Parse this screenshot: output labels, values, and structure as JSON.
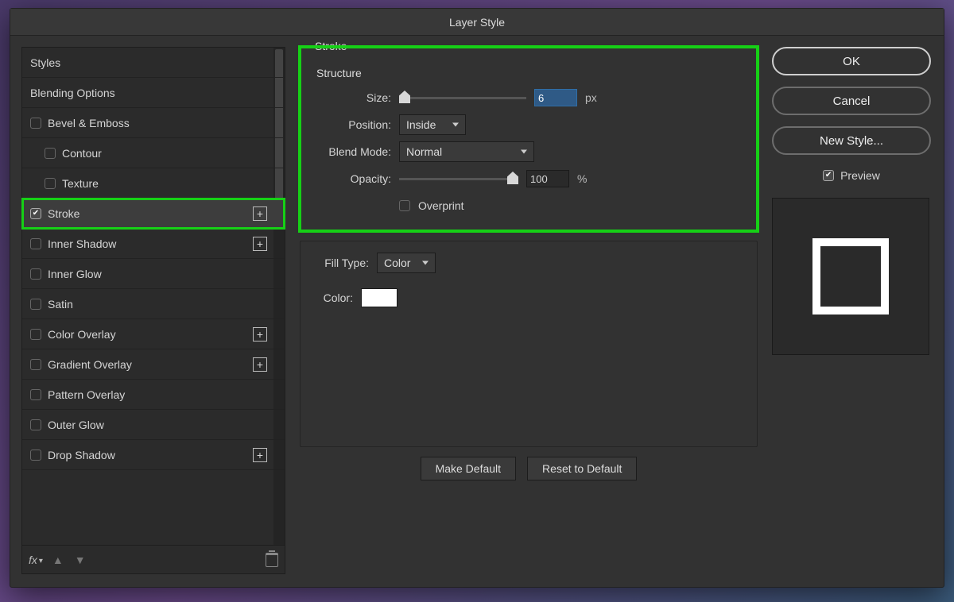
{
  "dialog": {
    "title": "Layer Style"
  },
  "sidebar": {
    "header_styles": "Styles",
    "header_blending": "Blending Options",
    "items": [
      {
        "label": "Bevel & Emboss",
        "checked": false,
        "plus": false,
        "indent": 0
      },
      {
        "label": "Contour",
        "checked": false,
        "plus": false,
        "indent": 1
      },
      {
        "label": "Texture",
        "checked": false,
        "plus": false,
        "indent": 1
      },
      {
        "label": "Stroke",
        "checked": true,
        "plus": true,
        "indent": 0,
        "selected": true,
        "green": true
      },
      {
        "label": "Inner Shadow",
        "checked": false,
        "plus": true,
        "indent": 0
      },
      {
        "label": "Inner Glow",
        "checked": false,
        "plus": false,
        "indent": 0
      },
      {
        "label": "Satin",
        "checked": false,
        "plus": false,
        "indent": 0
      },
      {
        "label": "Color Overlay",
        "checked": false,
        "plus": true,
        "indent": 0
      },
      {
        "label": "Gradient Overlay",
        "checked": false,
        "plus": true,
        "indent": 0
      },
      {
        "label": "Pattern Overlay",
        "checked": false,
        "plus": false,
        "indent": 0
      },
      {
        "label": "Outer Glow",
        "checked": false,
        "plus": false,
        "indent": 0
      },
      {
        "label": "Drop Shadow",
        "checked": false,
        "plus": true,
        "indent": 0
      }
    ],
    "footer_fx": "fx"
  },
  "main": {
    "panel_title": "Stroke",
    "structure_title": "Structure",
    "size_label": "Size:",
    "size_value": "6",
    "size_unit": "px",
    "position_label": "Position:",
    "position_value": "Inside",
    "blendmode_label": "Blend Mode:",
    "blendmode_value": "Normal",
    "opacity_label": "Opacity:",
    "opacity_value": "100",
    "opacity_unit": "%",
    "overprint_label": "Overprint",
    "filltype_label": "Fill Type:",
    "filltype_value": "Color",
    "color_label": "Color:",
    "color_swatch": "#ffffff",
    "make_default": "Make Default",
    "reset_default": "Reset to Default"
  },
  "right": {
    "ok": "OK",
    "cancel": "Cancel",
    "new_style": "New Style...",
    "preview_label": "Preview",
    "preview_checked": true
  }
}
